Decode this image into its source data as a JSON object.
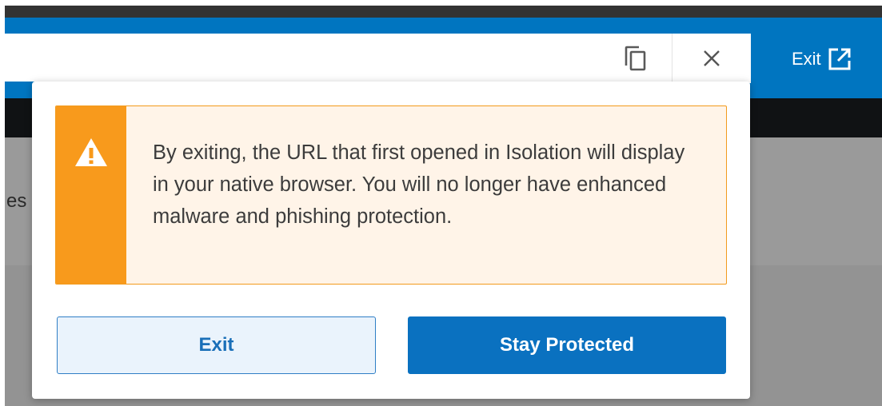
{
  "header": {
    "exit_label": "Exit",
    "exit_icon": "external-link-icon",
    "copy_icon": "copy-icon",
    "close_icon": "close-icon"
  },
  "background": {
    "partial_text": "es"
  },
  "dialog": {
    "warning_icon": "warning-triangle-icon",
    "warning_message": "By exiting, the URL that first opened in Isolation will display in your native browser. You will no longer have enhanced malware and phishing protection.",
    "exit_button_label": "Exit",
    "stay_button_label": "Stay Protected"
  },
  "colors": {
    "brand_blue": "#0075c0",
    "warning_orange": "#f89a1c",
    "warning_bg": "#fff4e8"
  }
}
